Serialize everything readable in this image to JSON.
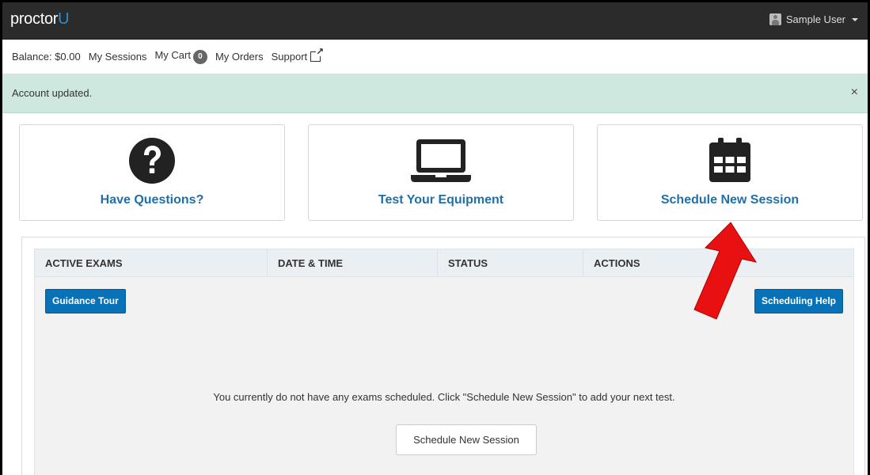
{
  "brand": {
    "logo_main": "proctor",
    "logo_accent": "U"
  },
  "user": {
    "name": "Sample User"
  },
  "subnav": {
    "balance": "Balance: $0.00",
    "sessions": "My Sessions",
    "cart": "My Cart",
    "cart_count": "0",
    "orders": "My Orders",
    "support": "Support"
  },
  "alert": {
    "message": "Account updated.",
    "close": "×"
  },
  "cards": [
    {
      "label": "Have Questions?",
      "icon": "question-circle-icon"
    },
    {
      "label": "Test Your Equipment",
      "icon": "laptop-icon"
    },
    {
      "label": "Schedule New Session",
      "icon": "calendar-icon"
    }
  ],
  "table": {
    "headers": [
      "ACTIVE EXAMS",
      "DATE & TIME",
      "STATUS",
      "ACTIONS"
    ],
    "guidance_button": "Guidance Tour",
    "help_button": "Scheduling Help",
    "empty_message": "You currently do not have any exams scheduled. Click \"Schedule New Session\" to add your next test.",
    "schedule_button": "Schedule New Session"
  },
  "colors": {
    "topbar": "#2b2b2b",
    "accent": "#2b8fd6",
    "card_label": "#1f6fa8",
    "button_primary": "#0872b8",
    "alert_bg": "#cfe8df",
    "annotation_arrow": "#e00000"
  }
}
